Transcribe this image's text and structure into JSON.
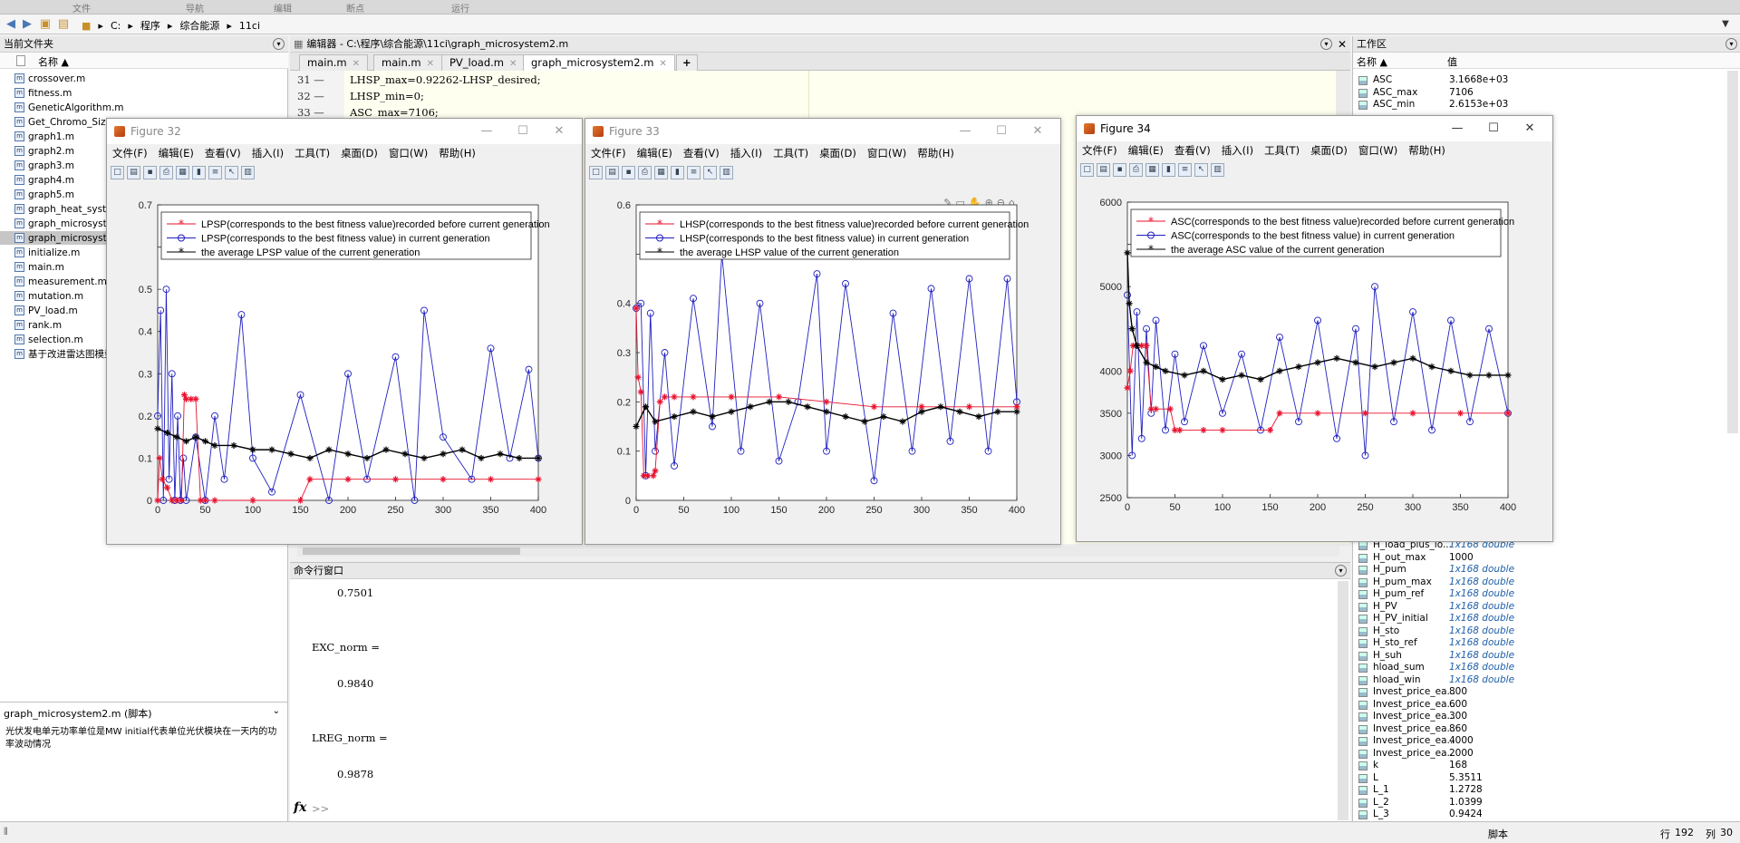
{
  "ribbon": {
    "tabs": [
      "文件",
      "导航",
      "编辑",
      "断点",
      "运行"
    ]
  },
  "address": {
    "path": [
      "C:",
      "程序",
      "综合能源",
      "11ci"
    ]
  },
  "current_folder": {
    "title": "当前文件夹",
    "column": "名称 ▲",
    "files": [
      "crossover.m",
      "fitness.m",
      "GeneticAlgorithm.m",
      "Get_Chromo_Size",
      "graph1.m",
      "graph2.m",
      "graph3.m",
      "graph4.m",
      "graph5.m",
      "graph_heat_syster",
      "graph_microsyste",
      "graph_microsyste",
      "initialize.m",
      "main.m",
      "measurement.m",
      "mutation.m",
      "PV_load.m",
      "rank.m",
      "selection.m",
      "基于改进雷达图模型"
    ],
    "selected_index": 11
  },
  "details": {
    "title": "graph_microsystem2.m (脚本)",
    "text": "光伏发电单元功率单位是MW   initial代表单位光伏模块在一天内的功率波动情况"
  },
  "editor": {
    "title": "编辑器 - C:\\程序\\综合能源\\11ci\\graph_microsystem2.m",
    "tabs": [
      "main.m",
      "main.m",
      "PV_load.m",
      "graph_microsystem2.m"
    ],
    "active_tab": 3,
    "lines": [
      {
        "num": "31 —",
        "text": "LHSP_max=0.92262-LHSP_desired;"
      },
      {
        "num": "32 —",
        "text": "LHSP_min=0;"
      },
      {
        "num": "33 —",
        "text": "ASC_max=7106;"
      }
    ]
  },
  "workspace": {
    "title": "工作区",
    "col_name": "名称 ▲",
    "col_value": "值",
    "top_vars": [
      {
        "name": "ASC",
        "value": "3.1668e+03"
      },
      {
        "name": "ASC_max",
        "value": "7106"
      },
      {
        "name": "ASC_min",
        "value": "2.6153e+03"
      }
    ],
    "vars": [
      {
        "name": "H_load_plus_lo...",
        "value": "1x168 double",
        "italic": true
      },
      {
        "name": "H_out_max",
        "value": "1000",
        "italic": false
      },
      {
        "name": "H_pum",
        "value": "1x168 double",
        "italic": true
      },
      {
        "name": "H_pum_max",
        "value": "1x168 double",
        "italic": true
      },
      {
        "name": "H_pum_ref",
        "value": "1x168 double",
        "italic": true
      },
      {
        "name": "H_PV",
        "value": "1x168 double",
        "italic": true
      },
      {
        "name": "H_PV_initial",
        "value": "1x168 double",
        "italic": true
      },
      {
        "name": "H_sto",
        "value": "1x168 double",
        "italic": true
      },
      {
        "name": "H_sto_ref",
        "value": "1x168 double",
        "italic": true
      },
      {
        "name": "H_suh",
        "value": "1x168 double",
        "italic": true
      },
      {
        "name": "hload_sum",
        "value": "1x168 double",
        "italic": true
      },
      {
        "name": "hload_win",
        "value": "1x168 double",
        "italic": true
      },
      {
        "name": "Invest_price_ea...",
        "value": "800",
        "italic": false
      },
      {
        "name": "Invest_price_ea...",
        "value": "600",
        "italic": false
      },
      {
        "name": "Invest_price_ea...",
        "value": "300",
        "italic": false
      },
      {
        "name": "Invest_price_ea...",
        "value": "860",
        "italic": false
      },
      {
        "name": "Invest_price_ea...",
        "value": "4000",
        "italic": false
      },
      {
        "name": "Invest_price_ea...",
        "value": "2000",
        "italic": false
      },
      {
        "name": "k",
        "value": "168",
        "italic": false
      },
      {
        "name": "L",
        "value": "5.3511",
        "italic": false
      },
      {
        "name": "L_1",
        "value": "1.2728",
        "italic": false
      },
      {
        "name": "L_2",
        "value": "1.0399",
        "italic": false
      },
      {
        "name": "L_3",
        "value": "0.9424",
        "italic": false
      }
    ]
  },
  "command_window": {
    "title": "命令行窗口",
    "lines": [
      "0.7501",
      "EXC_norm =",
      "0.9840",
      "LREG_norm =",
      "0.9878"
    ],
    "prompt": ">>"
  },
  "status": {
    "mode": "脚本",
    "row_label": "行",
    "row": "192",
    "col_label": "列",
    "col": "30"
  },
  "figure_menu": [
    "文件(F)",
    "编辑(E)",
    "查看(V)",
    "插入(I)",
    "工具(T)",
    "桌面(D)",
    "窗口(W)",
    "帮助(H)"
  ],
  "figures": [
    {
      "title": "Figure 32"
    },
    {
      "title": "Figure 33"
    },
    {
      "title": "Figure 34"
    }
  ],
  "colors": {
    "series_before": "#e8112d",
    "series_current": "#1f1fbf",
    "series_average": "#000000"
  },
  "chart_data": [
    {
      "type": "line",
      "xlim": [
        0,
        400
      ],
      "ylim": [
        0,
        0.7
      ],
      "xticks": [
        0,
        50,
        100,
        150,
        200,
        250,
        300,
        350,
        400
      ],
      "yticks": [
        0,
        0.1,
        0.2,
        0.3,
        0.4,
        0.5,
        0.6,
        0.7
      ],
      "ytick_labels": [
        "0",
        "0.1",
        "0.2",
        "0.3",
        "0.4",
        "0.5",
        "",
        "0.7"
      ],
      "legend_loc": "top",
      "series": [
        {
          "name": "LPSP(corresponds to the best fitness value)recorded before current generation",
          "marker": "*",
          "x": [
            0,
            2,
            5,
            10,
            15,
            20,
            25,
            28,
            30,
            35,
            40,
            45,
            50,
            60,
            100,
            150,
            160,
            200,
            250,
            300,
            350,
            400
          ],
          "y": [
            0.0,
            0.1,
            0.05,
            0.03,
            0.0,
            0.0,
            0.0,
            0.25,
            0.24,
            0.24,
            0.24,
            0.0,
            0.0,
            0.0,
            0.0,
            0.0,
            0.05,
            0.05,
            0.05,
            0.05,
            0.05,
            0.05
          ]
        },
        {
          "name": "LPSP(corresponds to the best fitness value) in current generation",
          "marker": "o",
          "x": [
            0,
            3,
            6,
            9,
            12,
            15,
            18,
            21,
            24,
            27,
            30,
            40,
            50,
            60,
            70,
            88,
            100,
            120,
            150,
            180,
            200,
            220,
            250,
            270,
            280,
            300,
            330,
            350,
            370,
            390,
            400
          ],
          "y": [
            0.2,
            0.45,
            0.0,
            0.5,
            0.05,
            0.3,
            0.0,
            0.2,
            0.0,
            0.1,
            0.0,
            0.15,
            0.0,
            0.2,
            0.05,
            0.44,
            0.1,
            0.02,
            0.25,
            0.0,
            0.3,
            0.05,
            0.34,
            0.0,
            0.45,
            0.15,
            0.05,
            0.36,
            0.1,
            0.31,
            0.1
          ]
        },
        {
          "name": "the average LPSP value of the current generation",
          "marker": "*",
          "x": [
            0,
            10,
            20,
            30,
            40,
            50,
            60,
            80,
            100,
            120,
            140,
            160,
            180,
            200,
            220,
            240,
            260,
            280,
            300,
            320,
            340,
            360,
            380,
            400
          ],
          "y": [
            0.17,
            0.16,
            0.15,
            0.14,
            0.15,
            0.14,
            0.13,
            0.13,
            0.12,
            0.12,
            0.11,
            0.1,
            0.12,
            0.11,
            0.1,
            0.12,
            0.11,
            0.1,
            0.11,
            0.12,
            0.1,
            0.11,
            0.1,
            0.1
          ]
        }
      ]
    },
    {
      "type": "line",
      "xlim": [
        0,
        400
      ],
      "ylim": [
        0,
        0.6
      ],
      "xticks": [
        0,
        50,
        100,
        150,
        200,
        250,
        300,
        350,
        400
      ],
      "yticks": [
        0,
        0.1,
        0.2,
        0.3,
        0.4,
        0.5,
        0.6
      ],
      "ytick_labels": [
        "0",
        "0.1",
        "0.2",
        "0.3",
        "0.4",
        "",
        "0.6"
      ],
      "legend_loc": "top",
      "series": [
        {
          "name": "LHSP(corresponds to the best fitness value)recorded before current generation",
          "marker": "*",
          "x": [
            0,
            2,
            5,
            8,
            12,
            18,
            20,
            25,
            30,
            40,
            60,
            100,
            150,
            200,
            250,
            300,
            350,
            400
          ],
          "y": [
            0.39,
            0.25,
            0.22,
            0.05,
            0.05,
            0.05,
            0.06,
            0.2,
            0.21,
            0.21,
            0.21,
            0.21,
            0.21,
            0.2,
            0.19,
            0.19,
            0.19,
            0.19
          ]
        },
        {
          "name": "LHSP(corresponds to the best fitness value) in current generation",
          "marker": "o",
          "x": [
            0,
            5,
            10,
            15,
            20,
            30,
            40,
            60,
            80,
            90,
            110,
            130,
            150,
            170,
            190,
            200,
            220,
            250,
            270,
            290,
            310,
            330,
            350,
            370,
            390,
            400
          ],
          "y": [
            0.39,
            0.4,
            0.05,
            0.38,
            0.1,
            0.3,
            0.07,
            0.41,
            0.15,
            0.5,
            0.1,
            0.4,
            0.08,
            0.2,
            0.46,
            0.1,
            0.44,
            0.04,
            0.38,
            0.1,
            0.43,
            0.12,
            0.45,
            0.1,
            0.45,
            0.2
          ]
        },
        {
          "name": "the average LHSP value of the current generation",
          "marker": "*",
          "x": [
            0,
            10,
            20,
            40,
            60,
            80,
            100,
            120,
            140,
            160,
            180,
            200,
            220,
            240,
            260,
            280,
            300,
            320,
            340,
            360,
            380,
            400
          ],
          "y": [
            0.15,
            0.19,
            0.16,
            0.17,
            0.18,
            0.17,
            0.18,
            0.19,
            0.2,
            0.2,
            0.19,
            0.18,
            0.17,
            0.16,
            0.17,
            0.16,
            0.18,
            0.19,
            0.18,
            0.17,
            0.18,
            0.18
          ]
        }
      ]
    },
    {
      "type": "line",
      "xlim": [
        0,
        400
      ],
      "ylim": [
        2500,
        6000
      ],
      "xticks": [
        0,
        50,
        100,
        150,
        200,
        250,
        300,
        350,
        400
      ],
      "yticks": [
        2500,
        3000,
        3500,
        4000,
        4500,
        5000,
        5500,
        6000
      ],
      "ytick_labels": [
        "2500",
        "3000",
        "3500",
        "4000",
        "",
        "5000",
        "",
        "6000"
      ],
      "legend_loc": "top",
      "series": [
        {
          "name": "ASC(corresponds to the best fitness value)recorded before current generation",
          "marker": "*",
          "x": [
            0,
            3,
            6,
            10,
            15,
            20,
            25,
            30,
            45,
            50,
            55,
            80,
            100,
            150,
            160,
            200,
            250,
            300,
            350,
            400
          ],
          "y": [
            3800,
            4000,
            4300,
            4300,
            4300,
            4300,
            3550,
            3550,
            3550,
            3300,
            3300,
            3300,
            3300,
            3300,
            3500,
            3500,
            3500,
            3500,
            3500,
            3500
          ]
        },
        {
          "name": "ASC(corresponds to the best fitness value) in current generation",
          "marker": "o",
          "x": [
            0,
            5,
            10,
            15,
            20,
            25,
            30,
            40,
            50,
            60,
            80,
            100,
            120,
            140,
            160,
            180,
            200,
            220,
            240,
            250,
            260,
            280,
            300,
            320,
            340,
            360,
            380,
            400
          ],
          "y": [
            4900,
            3000,
            4700,
            3200,
            4500,
            3500,
            4600,
            3300,
            4200,
            3400,
            4300,
            3500,
            4200,
            3300,
            4400,
            3400,
            4600,
            3200,
            4500,
            3000,
            5000,
            3400,
            4700,
            3300,
            4600,
            3400,
            4500,
            3500
          ]
        },
        {
          "name": "the average ASC value of the current generation",
          "marker": "*",
          "x": [
            0,
            2,
            5,
            10,
            20,
            30,
            40,
            60,
            80,
            100,
            120,
            140,
            160,
            180,
            200,
            220,
            240,
            260,
            280,
            300,
            320,
            340,
            360,
            380,
            400
          ],
          "y": [
            5400,
            4800,
            4500,
            4300,
            4100,
            4050,
            4000,
            3950,
            4000,
            3900,
            3950,
            3900,
            4000,
            4050,
            4100,
            4150,
            4100,
            4050,
            4100,
            4150,
            4050,
            4000,
            3950,
            3950,
            3950
          ]
        }
      ]
    }
  ]
}
